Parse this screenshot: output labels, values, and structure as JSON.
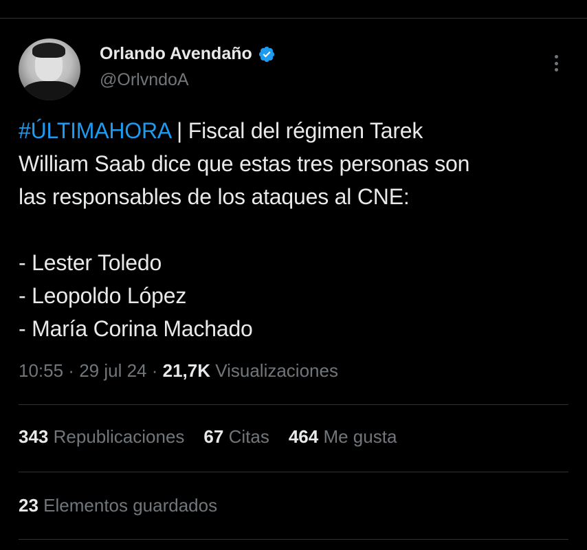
{
  "author": {
    "display_name": "Orlando Avendaño",
    "handle": "@OrlvndoA",
    "verified": true,
    "avatar_icon": "user-photo-avatar"
  },
  "tweet": {
    "hashtag": "#ÚLTIMAHORA",
    "line1_rest": " | Fiscal del régimen Tarek",
    "line2": "William Saab dice que estas tres personas son",
    "line3": "las responsables de los ataques al CNE:",
    "list": [
      "- Lester Toledo",
      "- Leopoldo López",
      "- María Corina Machado"
    ]
  },
  "meta": {
    "time": "10:55",
    "separator": " · ",
    "date": "29 jul 24",
    "views_count": "21,7K",
    "views_label": " Visualizaciones"
  },
  "stats": {
    "reposts_count": "343",
    "reposts_label": "Republicaciones",
    "quotes_count": "67",
    "quotes_label": "Citas",
    "likes_count": "464",
    "likes_label": "Me gusta"
  },
  "bookmarks": {
    "count": "23",
    "label": "Elementos guardados"
  },
  "colors": {
    "background": "#000000",
    "primary_text": "#e7e9ea",
    "secondary_text": "#71767b",
    "accent_blue": "#1d9bf0",
    "divider": "#2f3336"
  }
}
